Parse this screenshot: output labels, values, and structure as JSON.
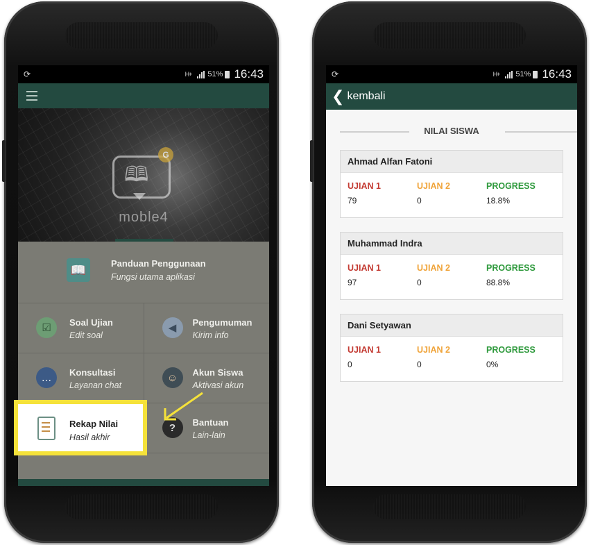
{
  "status_left": {
    "time": "16:43",
    "battery": "51%",
    "network": "H+"
  },
  "status_right": {
    "time": "16:43",
    "battery": "51%",
    "network": "H+"
  },
  "hero": {
    "brand": "moble4",
    "badge": "G"
  },
  "menu": {
    "guide": {
      "title": "Panduan Penggunaan",
      "subtitle": "Fungsi utama aplikasi"
    },
    "items": [
      {
        "title": "Soal Ujian",
        "subtitle": "Edit soal"
      },
      {
        "title": "Pengumuman",
        "subtitle": "Kirim info"
      },
      {
        "title": "Konsultasi",
        "subtitle": "Layanan chat"
      },
      {
        "title": "Akun Siswa",
        "subtitle": "Aktivasi akun"
      },
      {
        "title": "Rekap Nilai",
        "subtitle": "Hasil akhir"
      },
      {
        "title": "Bantuan",
        "subtitle": "Lain-lain"
      }
    ]
  },
  "right": {
    "back_label": "kembali",
    "section_title": "NILAI SISWA",
    "columns": {
      "exam1": "UJIAN 1",
      "exam2": "UJIAN 2",
      "progress": "PROGRESS"
    },
    "students": [
      {
        "name": "Ahmad Alfan Fatoni",
        "exam1": "79",
        "exam2": "0",
        "progress": "18.8%"
      },
      {
        "name": "Muhammad Indra",
        "exam1": "97",
        "exam2": "0",
        "progress": "88.8%"
      },
      {
        "name": "Dani Setyawan",
        "exam1": "0",
        "exam2": "0",
        "progress": "0%"
      }
    ]
  },
  "colors": {
    "primary": "#234a40",
    "highlight": "#f5e23a",
    "exam1": "#c33a32",
    "exam2": "#f0a43a",
    "progress": "#2f9a3d"
  }
}
